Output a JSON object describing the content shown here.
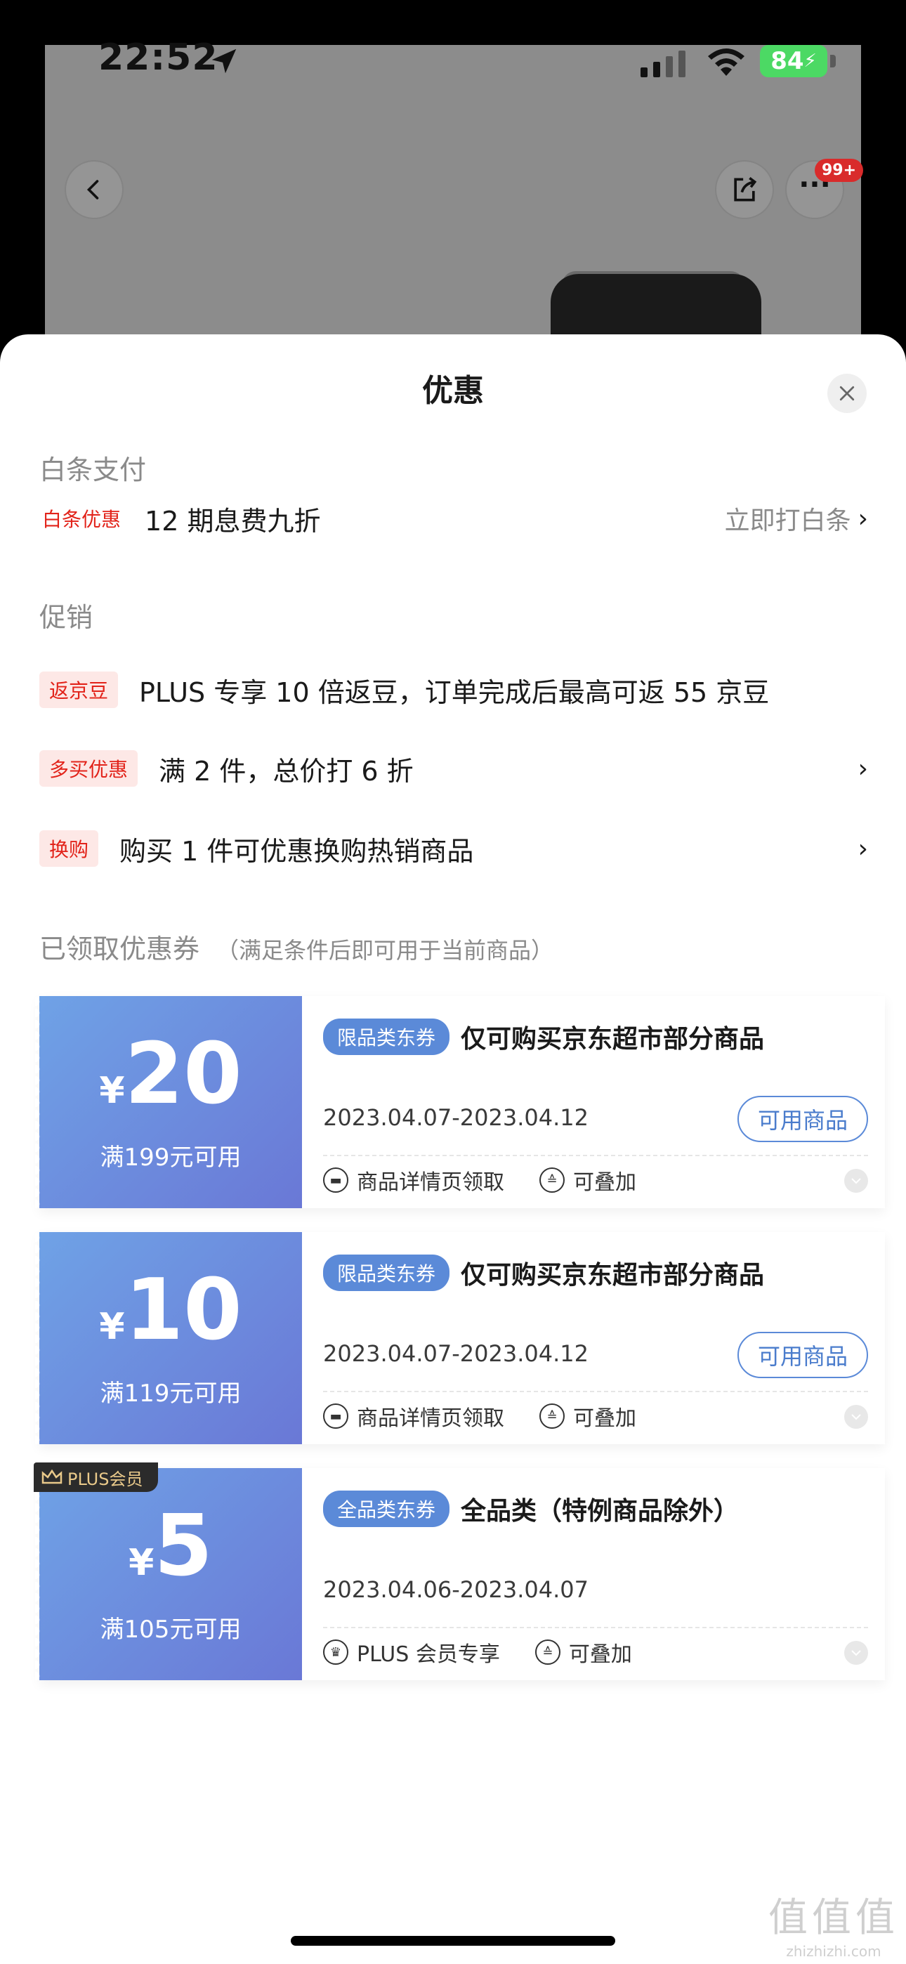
{
  "status": {
    "time": "22:52",
    "battery": "84"
  },
  "header": {
    "badge": "99+"
  },
  "sheet": {
    "title": "优惠"
  },
  "baitiao": {
    "section": "白条支付",
    "tag": "白条优惠",
    "text": "12 期息费九折",
    "action": "立即打白条"
  },
  "promo": {
    "section": "促销",
    "items": [
      {
        "tag": "返京豆",
        "text": "PLUS 专享 10 倍返豆，订单完成后最高可返 55 京豆"
      },
      {
        "tag": "多买优惠",
        "text": "满 2 件，总价打 6 折"
      },
      {
        "tag": "换购",
        "text": "购买 1 件可优惠换购热销商品"
      }
    ]
  },
  "coupons": {
    "title": "已领取优惠券",
    "subtitle": "（满足条件后即可用于当前商品）",
    "items": [
      {
        "yen": "¥",
        "amount": "20",
        "condition": "满199元可用",
        "type_tag": "限品类东券",
        "desc": "仅可购买京东超市部分商品",
        "date": "2023.04.07-2023.04.12",
        "button": "可用商品",
        "meta1": "商品详情页领取",
        "meta2": "可叠加"
      },
      {
        "yen": "¥",
        "amount": "10",
        "condition": "满119元可用",
        "type_tag": "限品类东券",
        "desc": "仅可购买京东超市部分商品",
        "date": "2023.04.07-2023.04.12",
        "button": "可用商品",
        "meta1": "商品详情页领取",
        "meta2": "可叠加"
      },
      {
        "yen": "¥",
        "amount": "5",
        "condition": "满105元可用",
        "plus_badge": "PLUS会员",
        "type_tag": "全品类东券",
        "desc": "全品类（特例商品除外）",
        "date": "2023.04.06-2023.04.07",
        "meta1": "PLUS 会员专享",
        "meta2": "可叠加"
      }
    ]
  },
  "watermark": {
    "big": "值值值",
    "small": "zhizhizhi.com"
  },
  "colors": {
    "accent": "#e2231a",
    "coupon_blue": "#5b8ad8"
  }
}
